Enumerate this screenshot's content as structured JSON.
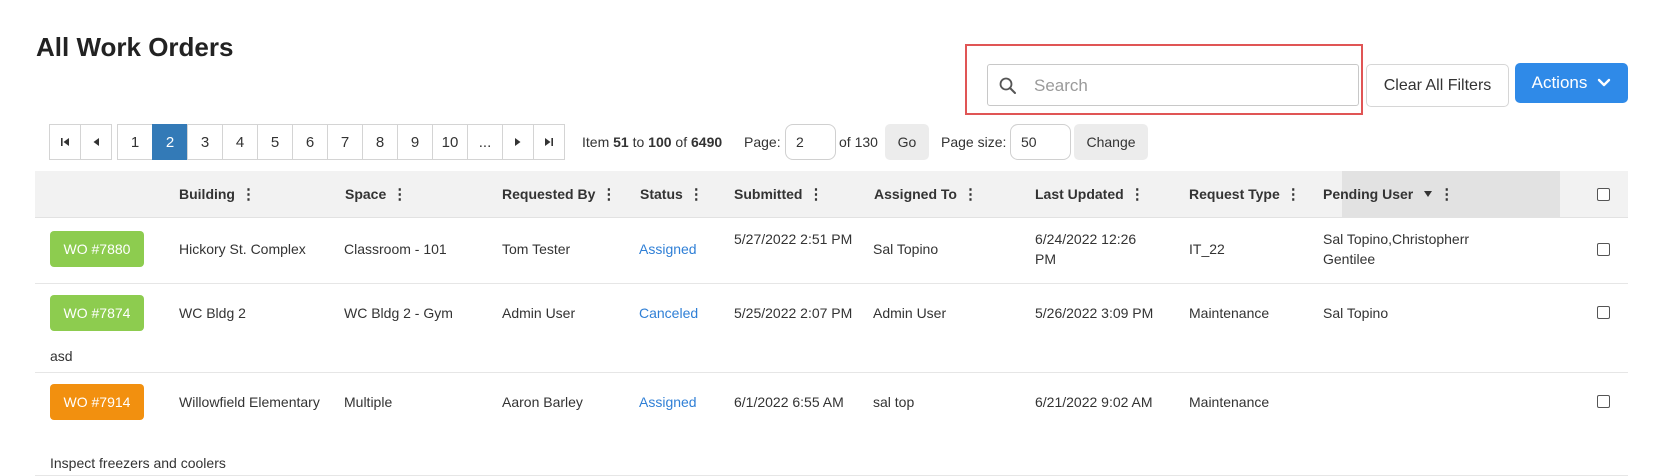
{
  "page_title": "All Work Orders",
  "search": {
    "placeholder": "Search",
    "value": ""
  },
  "toolbar": {
    "clear_filters_label": "Clear All Filters",
    "actions_label": "Actions"
  },
  "pagination": {
    "pages": [
      "1",
      "2",
      "3",
      "4",
      "5",
      "6",
      "7",
      "8",
      "9",
      "10",
      "..."
    ],
    "active_page": "2",
    "item_label": "Item",
    "item_from": "51",
    "to_label": "to",
    "item_to": "100",
    "of_label": "of",
    "item_total": "6490",
    "page_label": "Page:",
    "page_value": "2",
    "of_pages": "of 130",
    "go_label": "Go",
    "page_size_label": "Page size:",
    "page_size_value": "50",
    "change_label": "Change"
  },
  "columns": {
    "building": "Building",
    "space": "Space",
    "requested_by": "Requested By",
    "status": "Status",
    "submitted": "Submitted",
    "assigned_to": "Assigned To",
    "last_updated": "Last Updated",
    "request_type": "Request Type",
    "pending_user": "Pending User"
  },
  "rows": [
    {
      "wo": "WO #7880",
      "wo_color": "#8dcc4f",
      "building": "Hickory St. Complex",
      "space": "Classroom - 101",
      "requested_by": "Tom Tester",
      "status": "Assigned",
      "submitted": "5/27/2022 2:51 PM",
      "assigned_to": "Sal Topino",
      "last_updated": "6/24/2022 12:26 PM",
      "request_type": "IT_22",
      "pending_user": "Sal Topino,Christopherr Gentilee",
      "note": ""
    },
    {
      "wo": "WO #7874",
      "wo_color": "#8dcc4f",
      "building": "WC Bldg 2",
      "space": "WC Bldg 2 - Gym",
      "requested_by": "Admin User",
      "status": "Canceled",
      "submitted": "5/25/2022 2:07 PM",
      "assigned_to": "Admin User",
      "last_updated": "5/26/2022 3:09 PM",
      "request_type": "Maintenance",
      "pending_user": "Sal Topino",
      "note": "asd"
    },
    {
      "wo": "WO #7914",
      "wo_color": "#f2900f",
      "building": "Willowfield Elementary",
      "space": "Multiple",
      "requested_by": "Aaron Barley",
      "status": "Assigned",
      "submitted": "6/1/2022 6:55 AM",
      "assigned_to": "sal top",
      "last_updated": "6/21/2022 9:02 AM",
      "request_type": "Maintenance",
      "pending_user": "",
      "note": "Inspect freezers and coolers"
    }
  ]
}
